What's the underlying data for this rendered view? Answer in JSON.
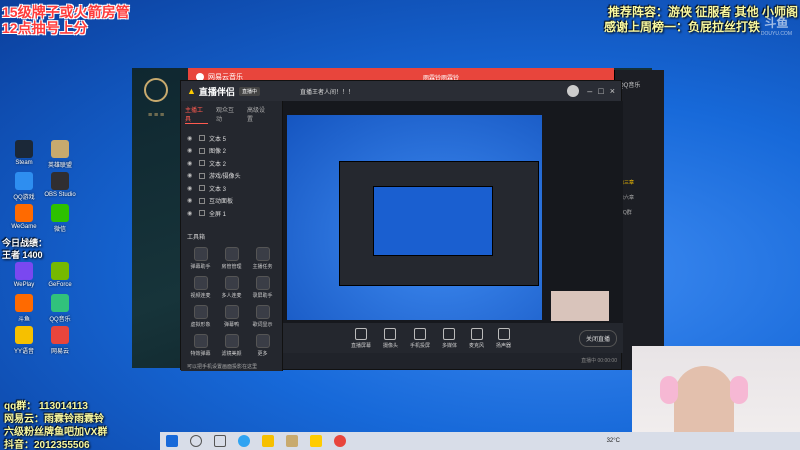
{
  "overlay": {
    "title_line1": "15级牌子或火箭房管",
    "title_line2": "12点抽号上分",
    "top_right_line1": "推荐阵容：游侠 征服者 其他 小师阁",
    "top_right_line2": "感谢上周榜一：负屁拉丝打铁",
    "watermark": "斗鱼",
    "watermark_url": "DOUYU.COM",
    "stats_label": "今日战绩：",
    "stats_value": "王者 1400",
    "qq_group": "qq群： 113014113",
    "netease": "网易云：雨霖铃雨霖铃",
    "fan_group": "六级粉丝牌鱼吧加VX群",
    "douyin": "抖音：2012355506"
  },
  "desktop_icons": [
    {
      "label": "Steam",
      "color": "#1b2838"
    },
    {
      "label": "英雄联盟",
      "color": "#c8aa6e"
    },
    {
      "label": "QQ游戏",
      "color": "#2e8ef0"
    },
    {
      "label": "OBS Studio",
      "color": "#302e31"
    },
    {
      "label": "WeGame",
      "color": "#ff6a00"
    },
    {
      "label": "微信",
      "color": "#2dc100"
    },
    {
      "label": "WePlay",
      "color": "#7a48f0"
    },
    {
      "label": "GeForce",
      "color": "#76b900"
    },
    {
      "label": "斗鱼",
      "color": "#ff6a00"
    },
    {
      "label": "QQ音乐",
      "color": "#31c27c"
    },
    {
      "label": "YY语音",
      "color": "#f6c000"
    },
    {
      "label": "网易云",
      "color": "#e8453c"
    }
  ],
  "music_window": {
    "title": "网易云音乐",
    "user": "雨霖铃雨霖铃"
  },
  "obs": {
    "title": "直播伴侣",
    "status": "直播中",
    "room_title": "直播王者人间！！！",
    "tabs": [
      "主播工具",
      "观众互动",
      "高级设置"
    ],
    "scenes": [
      "文本 5",
      "图像 2",
      "文本 2",
      "游戏/摄像头",
      "文本 3",
      "互动面板",
      "全屏 1"
    ],
    "tools_title": "工具箱",
    "tools": [
      "弹幕助手",
      "房管管理",
      "主播任务",
      "视频连麦",
      "多人连麦",
      "录屏助手",
      "虚拟形象",
      "弹幕鸭",
      "歌词显示",
      "特效弹幕",
      "滤镜美颜",
      "更多"
    ],
    "bottom_tools": [
      "直播屏幕",
      "摄像头",
      "手机投屏",
      "多媒体",
      "麦克风",
      "扬声器"
    ],
    "start_button": "关闭直播",
    "hint": "可以把手机设置画面投影在这里",
    "stats": "直播中 00:00:00"
  },
  "right_panel": {
    "label": "QQ音乐",
    "items": [
      "第三章",
      "第六章",
      "QQ群"
    ]
  },
  "taskbar": {
    "temperature": "32°C"
  }
}
